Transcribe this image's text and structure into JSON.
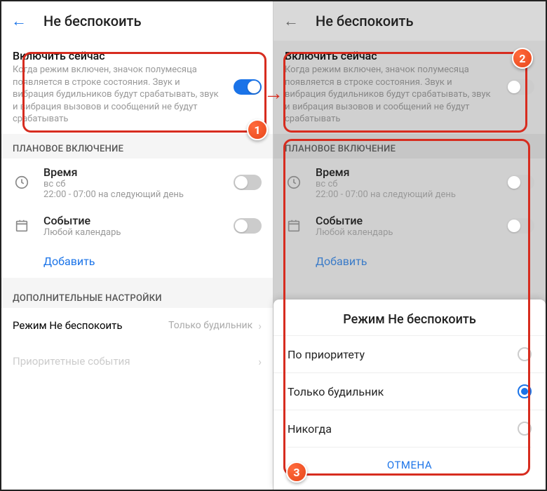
{
  "left": {
    "header_title": "Не беспокоить",
    "enable_title": "Включить сейчас",
    "enable_desc": "Когда режим включен, значок полумесяца появляется в строке состояния. Звук и вибрация будильников будут срабатывать, звук и вибрация вызовов и сообщений не будут срабатывать",
    "enable_on": true,
    "scheduled_label": "ПЛАНОВОЕ ВКЛЮЧЕНИЕ",
    "time_title": "Время",
    "time_sub1": "вс сб",
    "time_sub2": "22:00 - 07:00 на следующий день",
    "event_title": "Событие",
    "event_sub": "Любой календарь",
    "add_label": "Добавить",
    "extra_label": "ДОПОЛНИТЕЛЬНЫЕ НАСТРОЙКИ",
    "mode_label": "Режим Не беспокоить",
    "mode_value": "Только будильник",
    "priority_label": "Приоритетные события"
  },
  "right": {
    "header_title": "Не беспокоить",
    "enable_title": "Включить сейчас",
    "enable_desc": "Когда режим включен, значок полумесяца появляется в строке состояния. Звук и вибрация будильников будут срабатывать, звук и вибрация вызовов и сообщений не будут срабатывать",
    "scheduled_label": "ПЛАНОВОЕ ВКЛЮЧЕНИЕ",
    "time_title": "Время",
    "time_sub1": "вс сб",
    "time_sub2": "22:00 - 07:00 на следующий день",
    "event_title": "Событие",
    "event_sub": "Любой календарь",
    "add_label": "Добавить",
    "modal_title": "Режим Не беспокоить",
    "opt1": "По приоритету",
    "opt2": "Только будильник",
    "opt3": "Никогда",
    "cancel": "ОТМЕНА"
  },
  "badges": {
    "b1": "1",
    "b2": "2",
    "b3": "3"
  }
}
